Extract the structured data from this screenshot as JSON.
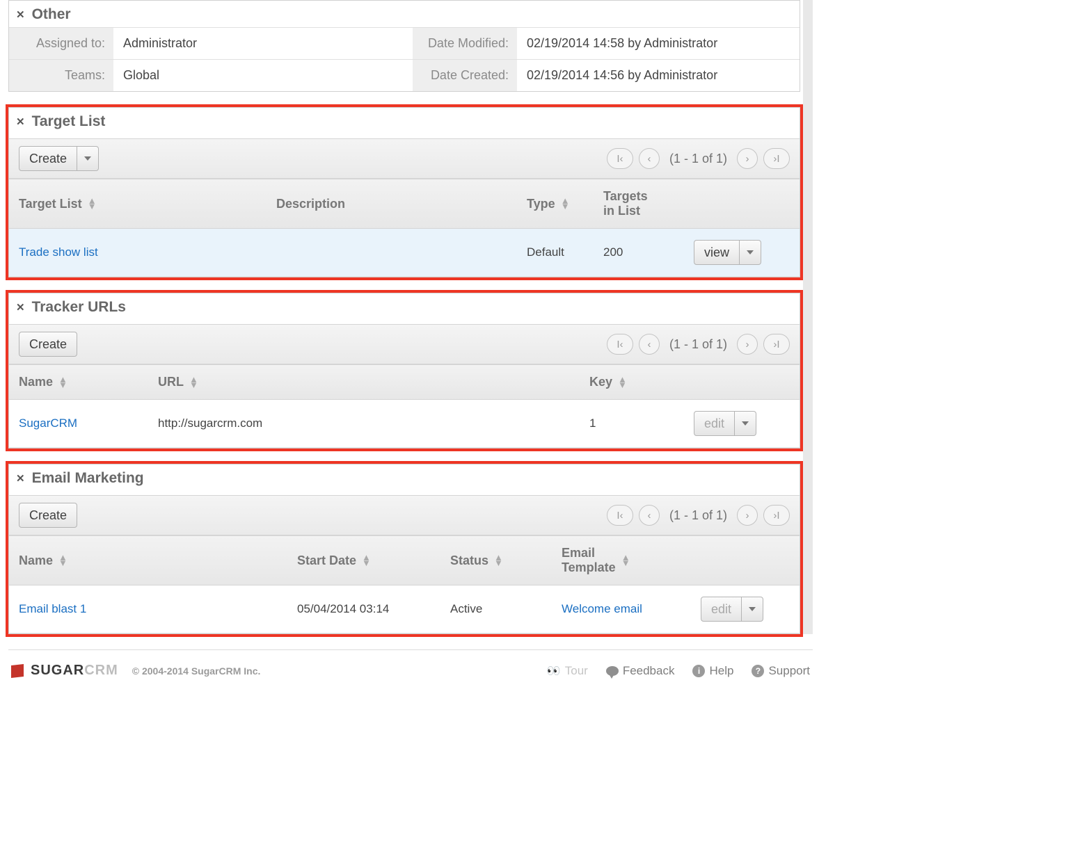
{
  "other": {
    "title": "Other",
    "assigned_label": "Assigned to:",
    "assigned_val": "Administrator",
    "teams_label": "Teams:",
    "teams_val": "Global",
    "modified_label": "Date Modified:",
    "modified_val": "02/19/2014 14:58 by Administrator",
    "created_label": "Date Created:",
    "created_val": "02/19/2014 14:56 by Administrator"
  },
  "target_list": {
    "title": "Target List",
    "create_label": "Create",
    "pager": "(1 - 1 of 1)",
    "columns": {
      "c1": "Target List",
      "c2": "Description",
      "c3": "Type",
      "c4": "Targets\nin List"
    },
    "row": {
      "name": "Trade show list",
      "desc": "",
      "type": "Default",
      "count": "200",
      "action": "view"
    }
  },
  "tracker_urls": {
    "title": "Tracker URLs",
    "create_label": "Create",
    "pager": "(1 - 1 of 1)",
    "columns": {
      "c1": "Name",
      "c2": "URL",
      "c3": "Key"
    },
    "row": {
      "name": "SugarCRM",
      "url": "http://sugarcrm.com",
      "key": "1",
      "action": "edit"
    }
  },
  "email_marketing": {
    "title": "Email Marketing",
    "create_label": "Create",
    "pager": "(1 - 1 of 1)",
    "columns": {
      "c1": "Name",
      "c2": "Start Date",
      "c3": "Status",
      "c4": "Email\nTemplate"
    },
    "row": {
      "name": "Email blast 1",
      "start": "05/04/2014 03:14",
      "status": "Active",
      "template": "Welcome email",
      "action": "edit"
    }
  },
  "footer": {
    "brand1": "SUGAR",
    "brand2": "CRM",
    "copy": "© 2004-2014 SugarCRM Inc.",
    "tour": "Tour",
    "feedback": "Feedback",
    "help": "Help",
    "support": "Support"
  }
}
